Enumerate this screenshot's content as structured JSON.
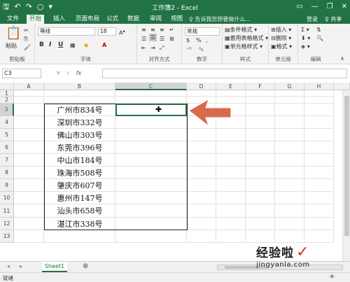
{
  "window": {
    "title": "工作簿2 - Excel",
    "accent": "#217346"
  },
  "qat": {
    "save_icon": "save-icon",
    "undo_icon": "undo-icon",
    "redo_icon": "redo-icon",
    "touch_icon": "touch-icon",
    "more_icon": "customize-qat-icon"
  },
  "tabs": [
    "文件",
    "开始",
    "插入",
    "页面布局",
    "公式",
    "数据",
    "审阅",
    "视图"
  ],
  "active_tab": "开始",
  "tell_me": "♀ 告诉我您想要做什么...",
  "sign_in": "登录",
  "share": "♀ 共享",
  "ribbon": {
    "clipboard": {
      "label": "剪贴板",
      "paste": "粘贴"
    },
    "font": {
      "label": "字体",
      "name": "等线",
      "size": "18",
      "bold": "B",
      "italic": "I",
      "underline": "U"
    },
    "alignment": {
      "label": "对齐方式"
    },
    "number": {
      "label": "数字",
      "format": "常规"
    },
    "styles": {
      "label": "样式",
      "cond": "条件格式 ▾",
      "table": "套用表格格式 ▾",
      "cell": "单元格样式 ▾"
    },
    "cells": {
      "label": "单元格",
      "insert": "插入 ▾",
      "delete": "删除 ▾",
      "format": "格式 ▾"
    },
    "editing": {
      "label": "编辑"
    }
  },
  "formula_bar": {
    "name_box": "C3",
    "cancel": "✕",
    "enter": "✓",
    "fx": "fx",
    "value": ""
  },
  "columns": [
    "A",
    "B",
    "C",
    "D",
    "E",
    "F",
    "G",
    "H"
  ],
  "rows": [
    "1",
    "2",
    "3",
    "4",
    "5",
    "6",
    "7",
    "8",
    "9",
    "10",
    "11",
    "12",
    "13"
  ],
  "active_cell": "C3",
  "cells_B": [
    "广州市834号",
    "深圳市332号",
    "佛山市303号",
    "东莞市396号",
    "中山市184号",
    "珠海市508号",
    "肇庆市607号",
    "惠州市147号",
    "汕头市658号",
    "湛江市338号"
  ],
  "arrow_color": "#d9694b",
  "sheet_tabs": [
    "Sheet1"
  ],
  "add_sheet": "⊕",
  "status": {
    "ready": "就绪",
    "zoom": "+"
  },
  "watermark": {
    "line1": "经验啦",
    "check": "✓",
    "line2": "jingyanla.com"
  }
}
